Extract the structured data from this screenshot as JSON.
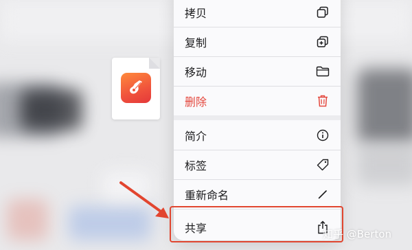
{
  "menu": {
    "items": [
      {
        "label": "拷贝",
        "icon": "copy-icon"
      },
      {
        "label": "复制",
        "icon": "duplicate-icon"
      },
      {
        "label": "移动",
        "icon": "folder-icon"
      },
      {
        "label": "删除",
        "icon": "trash-icon",
        "danger": true
      },
      {
        "label": "简介",
        "icon": "info-icon"
      },
      {
        "label": "标签",
        "icon": "tag-icon"
      },
      {
        "label": "重新命名",
        "icon": "pencil-icon"
      },
      {
        "label": "共享",
        "icon": "share-icon"
      }
    ]
  },
  "file": {
    "icon": "garageband-app-icon"
  },
  "watermark": {
    "text": "知乎 @Berton"
  },
  "colors": {
    "danger": "#e4473d",
    "highlight": "#e0452f",
    "arrow": "#e2452f"
  }
}
